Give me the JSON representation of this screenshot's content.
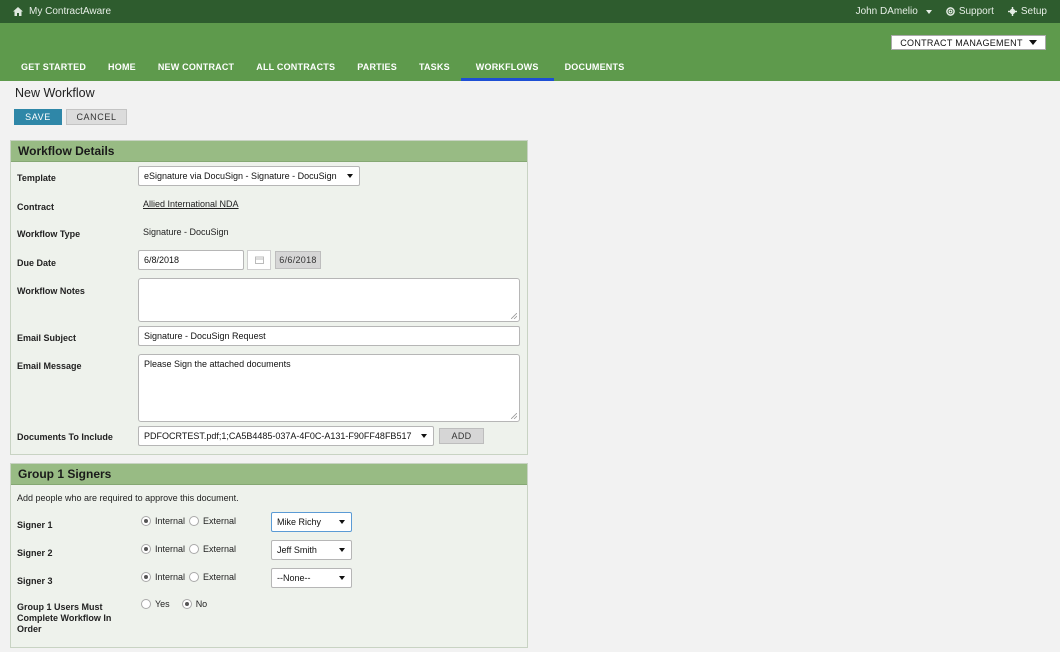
{
  "topbar": {
    "home_label": "My ContractAware",
    "user_label": "John DAmelio",
    "support_label": "Support",
    "setup_label": "Setup"
  },
  "header": {
    "module_select": "CONTRACT MANAGEMENT",
    "tabs": [
      {
        "label": "GET STARTED"
      },
      {
        "label": "HOME"
      },
      {
        "label": "NEW CONTRACT"
      },
      {
        "label": "ALL CONTRACTS"
      },
      {
        "label": "PARTIES"
      },
      {
        "label": "TASKS"
      },
      {
        "label": "WORKFLOWS",
        "active": true
      },
      {
        "label": "DOCUMENTS"
      }
    ]
  },
  "page": {
    "title": "New Workflow",
    "save_label": "SAVE",
    "cancel_label": "CANCEL"
  },
  "workflow_details": {
    "heading": "Workflow Details",
    "template_label": "Template",
    "template_value": "eSignature via DocuSign - Signature - DocuSign",
    "contract_label": "Contract",
    "contract_value": "Allied International NDA",
    "type_label": "Workflow Type",
    "type_value": "Signature - DocuSign",
    "due_label": "Due Date",
    "due_value": "6/8/2018",
    "due_today_button": "6/6/2018",
    "notes_label": "Workflow Notes",
    "notes_value": "",
    "subject_label": "Email Subject",
    "subject_value": "Signature - DocuSign Request",
    "message_label": "Email Message",
    "message_value": "Please Sign the attached documents",
    "docs_label": "Documents To Include",
    "docs_value": "PDFOCRTEST.pdf;1;CA5B4485-037A-4F0C-A131-F90FF48FB517",
    "add_label": "ADD"
  },
  "signers": {
    "heading": "Group 1 Signers",
    "note": "Add people who are required to approve this document.",
    "internal_label": "Internal",
    "external_label": "External",
    "rows": [
      {
        "label": "Signer 1",
        "value": "Mike Richy"
      },
      {
        "label": "Signer 2",
        "value": "Jeff Smith"
      },
      {
        "label": "Signer 3",
        "value": "--None--"
      }
    ],
    "order_label": "Group 1 Users Must Complete Workflow In Order",
    "yes_label": "Yes",
    "no_label": "No",
    "order_value": "No"
  },
  "colors": {
    "topbar": "#2e5c2e",
    "header": "#5e9a4c",
    "active_tab_underline": "#1e4fd4",
    "save_button": "#2f87a8",
    "panel_head": "#98bb84"
  }
}
